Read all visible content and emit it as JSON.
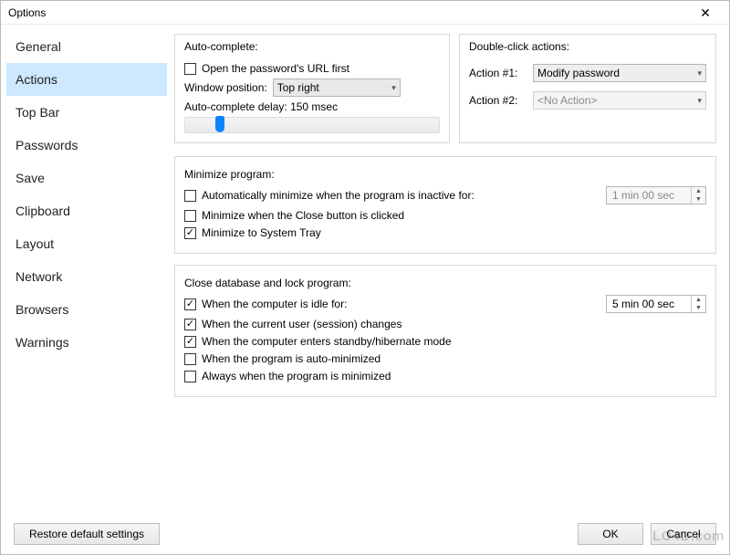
{
  "window": {
    "title": "Options"
  },
  "sidebar": {
    "items": [
      {
        "label": "General"
      },
      {
        "label": "Actions"
      },
      {
        "label": "Top Bar"
      },
      {
        "label": "Passwords"
      },
      {
        "label": "Save"
      },
      {
        "label": "Clipboard"
      },
      {
        "label": "Layout"
      },
      {
        "label": "Network"
      },
      {
        "label": "Browsers"
      },
      {
        "label": "Warnings"
      }
    ],
    "selected_index": 1
  },
  "autocomplete": {
    "title": "Auto-complete:",
    "open_url_label": "Open the password's URL first",
    "open_url_checked": false,
    "window_position_label": "Window position:",
    "window_position_value": "Top right",
    "delay_label": "Auto-complete delay: 150 msec",
    "slider_percent": 12
  },
  "doubleclick": {
    "title": "Double-click actions:",
    "action1_label": "Action #1:",
    "action1_value": "Modify password",
    "action2_label": "Action #2:",
    "action2_value": "<No Action>"
  },
  "minimize": {
    "title": "Minimize program:",
    "opt1_label": "Automatically minimize when the program is inactive for:",
    "opt1_checked": false,
    "opt1_value": "1 min 00 sec",
    "opt2_label": "Minimize when the Close button is clicked",
    "opt2_checked": false,
    "opt3_label": "Minimize to System Tray",
    "opt3_checked": true
  },
  "lock": {
    "title": "Close database and lock program:",
    "opt1_label": "When the computer is idle for:",
    "opt1_checked": true,
    "opt1_value": "5 min 00 sec",
    "opt2_label": "When the current user (session) changes",
    "opt2_checked": true,
    "opt3_label": "When the computer enters standby/hibernate mode",
    "opt3_checked": true,
    "opt4_label": "When the program is auto-minimized",
    "opt4_checked": false,
    "opt5_label": "Always when the program is minimized",
    "opt5_checked": false
  },
  "footer": {
    "restore": "Restore default settings",
    "ok": "OK",
    "cancel": "Cancel"
  },
  "watermark": "LO4D.com"
}
